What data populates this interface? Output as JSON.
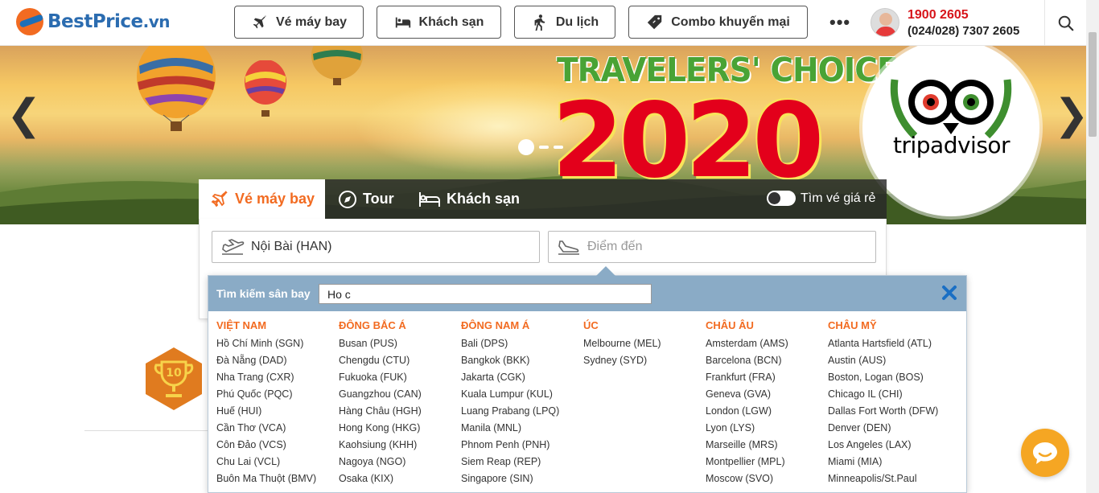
{
  "brand": {
    "name": "BestPrice",
    "domain": ".vn"
  },
  "nav": [
    {
      "label": "Vé máy bay",
      "icon": "plane-icon"
    },
    {
      "label": "Khách sạn",
      "icon": "bed-icon"
    },
    {
      "label": "Du lịch",
      "icon": "walking-icon"
    },
    {
      "label": "Combo khuyến mại",
      "icon": "tag-icon"
    }
  ],
  "more_label": "•••",
  "hotline": {
    "primary": "1900 2605",
    "secondary": "(024/028) 7307 2605"
  },
  "hero": {
    "headline": "TRAVELERS' CHOICE",
    "year": "2020",
    "partner": "tripadvisor",
    "prev": "❮",
    "next": "❯"
  },
  "search": {
    "tabs": [
      {
        "label": "Vé máy bay",
        "icon": "plane-icon",
        "active": true
      },
      {
        "label": "Tour",
        "icon": "compass-icon",
        "active": false
      },
      {
        "label": "Khách sạn",
        "icon": "bed-icon",
        "active": false
      }
    ],
    "cheap_toggle_label": "Tìm vé giá rẻ",
    "from_value": "Nội Bài (HAN)",
    "to_placeholder": "Điểm đến"
  },
  "airport_picker": {
    "label": "Tìm kiếm sân bay",
    "query": "Ho c",
    "columns": [
      {
        "title": "VIỆT NAM",
        "items": [
          "Hồ Chí Minh (SGN)",
          "Đà Nẵng (DAD)",
          "Nha Trang (CXR)",
          "Phú Quốc (PQC)",
          "Huế (HUI)",
          "Cần Thơ (VCA)",
          "Côn Đảo (VCS)",
          "Chu Lai (VCL)",
          "Buôn Ma Thuột (BMV)"
        ]
      },
      {
        "title": "ĐÔNG BẮC Á",
        "items": [
          "Busan (PUS)",
          "Chengdu (CTU)",
          "Fukuoka (FUK)",
          "Guangzhou (CAN)",
          "Hàng Châu (HGH)",
          "Hong Kong (HKG)",
          "Kaohsiung (KHH)",
          "Nagoya (NGO)",
          "Osaka (KIX)"
        ]
      },
      {
        "title": "ĐÔNG NAM Á",
        "items": [
          "Bali (DPS)",
          "Bangkok (BKK)",
          "Jakarta (CGK)",
          "Kuala Lumpur (KUL)",
          "Luang Prabang (LPQ)",
          "Manila (MNL)",
          "Phnom Penh (PNH)",
          "Siem Reap (REP)",
          "Singapore (SIN)"
        ]
      },
      {
        "title": "ÚC",
        "items": [
          "Melbourne (MEL)",
          "Sydney (SYD)"
        ]
      },
      {
        "title": "CHÂU ÂU",
        "items": [
          "Amsterdam (AMS)",
          "Barcelona (BCN)",
          "Frankfurt (FRA)",
          "Geneva (GVA)",
          "London (LGW)",
          "Lyon (LYS)",
          "Marseille (MRS)",
          "Montpellier (MPL)",
          "Moscow (SVO)"
        ]
      },
      {
        "title": "CHÂU MỸ",
        "items": [
          "Atlanta Hartsfield (ATL)",
          "Austin (AUS)",
          "Boston, Logan (BOS)",
          "Chicago IL (CHI)",
          "Dallas Fort Worth (DFW)",
          "Denver (DEN)",
          "Los Angeles (LAX)",
          "Miami (MIA)",
          "Minneapolis/St.Paul"
        ]
      }
    ]
  },
  "award_badge": "10",
  "colors": {
    "accent": "#f26b21",
    "brand_blue": "#2b6cb0",
    "hotline_red": "#d7141a",
    "picker_header": "#8aabc6"
  }
}
